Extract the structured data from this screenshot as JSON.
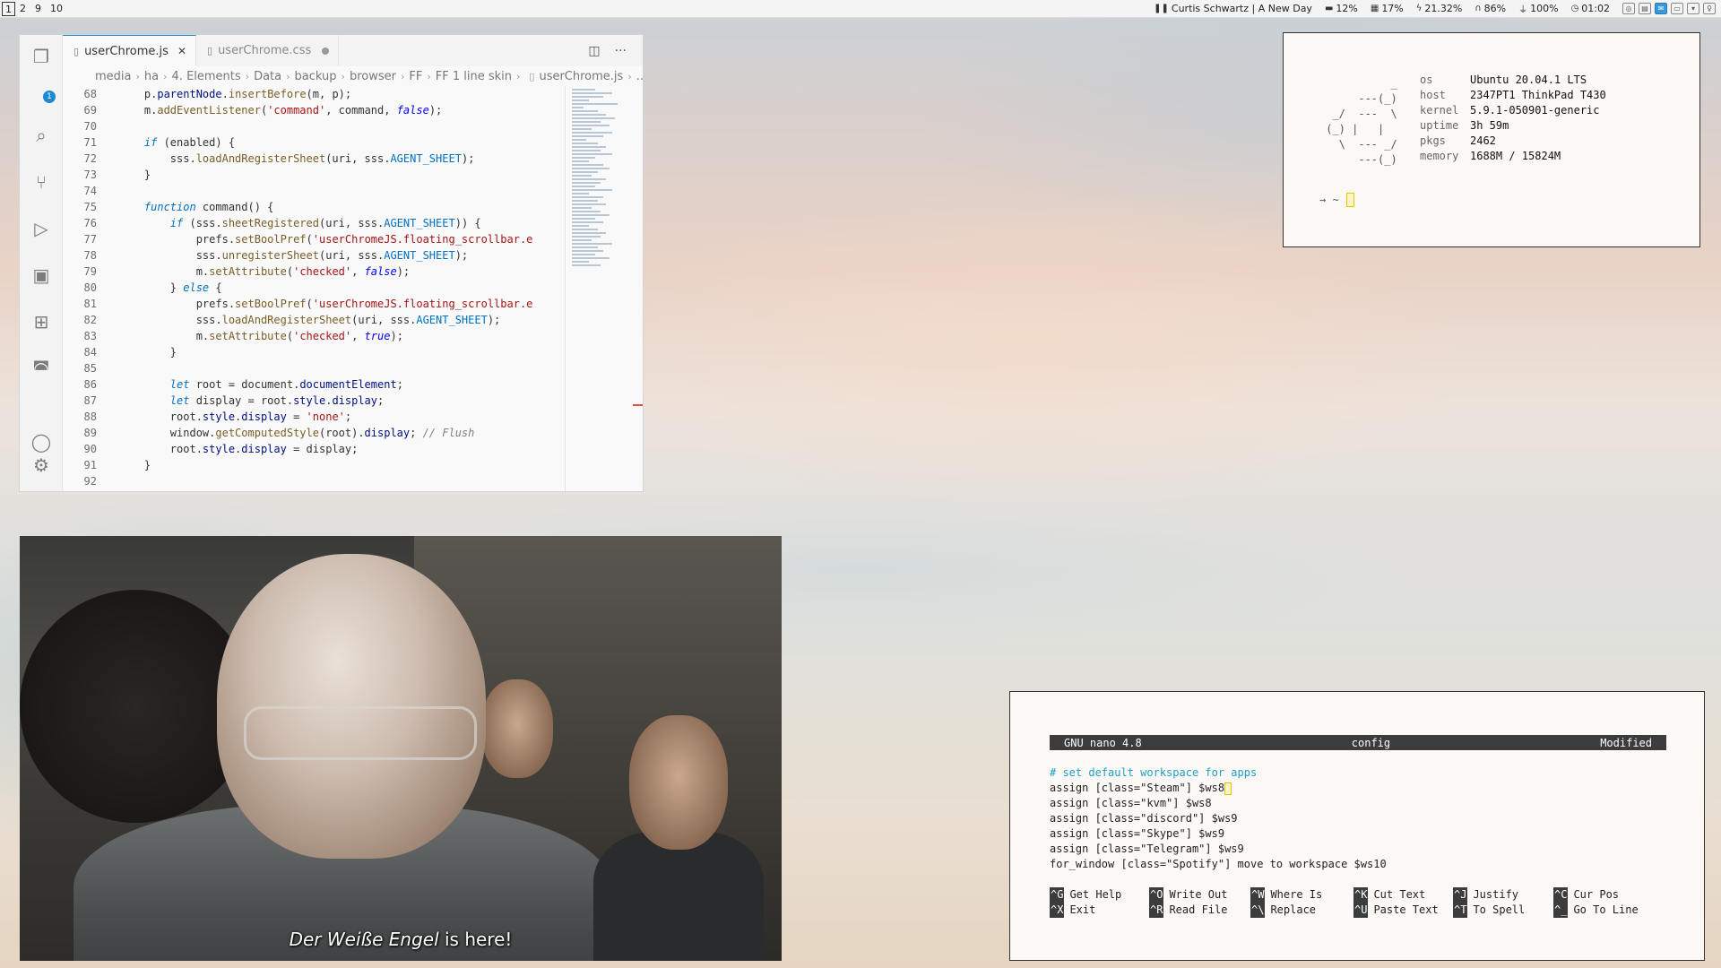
{
  "topbar": {
    "workspaces": [
      "1",
      "2",
      "9",
      "10"
    ],
    "active_workspace": "1",
    "now_playing": "Curtis Schwartz | A New Day",
    "disk": "12%",
    "memory": "17%",
    "cpu": "21.32%",
    "volume": "86%",
    "battery": "100%",
    "clock": "01:02"
  },
  "vscode": {
    "tabs": [
      {
        "label": "userChrome.js",
        "active": true
      },
      {
        "label": "userChrome.css",
        "active": false
      }
    ],
    "breadcrumb": [
      "media",
      "ha",
      "4. Elements",
      "Data",
      "backup",
      "browser",
      "FF",
      "FF 1 line skin",
      "userChrome.js",
      "..."
    ],
    "explorer_badge": "1",
    "lines": [
      {
        "n": "68",
        "text": "p.parentNode.insertBefore(m, p);"
      },
      {
        "n": "69",
        "text": "m.addEventListener('command', command, false);"
      },
      {
        "n": "70",
        "text": ""
      },
      {
        "n": "71",
        "text": "if (enabled) {"
      },
      {
        "n": "72",
        "text": "    sss.loadAndRegisterSheet(uri, sss.AGENT_SHEET);"
      },
      {
        "n": "73",
        "text": "}"
      },
      {
        "n": "74",
        "text": ""
      },
      {
        "n": "75",
        "text": "function command() {"
      },
      {
        "n": "76",
        "text": "    if (sss.sheetRegistered(uri, sss.AGENT_SHEET)) {"
      },
      {
        "n": "77",
        "text": "        prefs.setBoolPref('userChromeJS.floating_scrollbar.e"
      },
      {
        "n": "78",
        "text": "        sss.unregisterSheet(uri, sss.AGENT_SHEET);"
      },
      {
        "n": "79",
        "text": "        m.setAttribute('checked', false);"
      },
      {
        "n": "80",
        "text": "    } else {"
      },
      {
        "n": "81",
        "text": "        prefs.setBoolPref('userChromeJS.floating_scrollbar.e"
      },
      {
        "n": "82",
        "text": "        sss.loadAndRegisterSheet(uri, sss.AGENT_SHEET);"
      },
      {
        "n": "83",
        "text": "        m.setAttribute('checked', true);"
      },
      {
        "n": "84",
        "text": "    }"
      },
      {
        "n": "85",
        "text": ""
      },
      {
        "n": "86",
        "text": "    let root = document.documentElement;"
      },
      {
        "n": "87",
        "text": "    let display = root.style.display;"
      },
      {
        "n": "88",
        "text": "    root.style.display = 'none';"
      },
      {
        "n": "89",
        "text": "    window.getComputedStyle(root).display; // Flush"
      },
      {
        "n": "90",
        "text": "    root.style.display = display;"
      },
      {
        "n": "91",
        "text": "}"
      },
      {
        "n": "92",
        "text": ""
      }
    ]
  },
  "neofetch": {
    "rows": [
      {
        "key": "os",
        "value": "Ubuntu 20.04.1 LTS"
      },
      {
        "key": "host",
        "value": "2347PT1 ThinkPad T430"
      },
      {
        "key": "kernel",
        "value": "5.9.1-050901-generic"
      },
      {
        "key": "uptime",
        "value": "3h 59m"
      },
      {
        "key": "pkgs",
        "value": "2462"
      },
      {
        "key": "memory",
        "value": "1688M / 15824M"
      }
    ],
    "prompt": "→  ~"
  },
  "video": {
    "subtitle_italic": "Der Weiße Engel",
    "subtitle_rest": " is here!"
  },
  "nano": {
    "version": "GNU nano 4.8",
    "filename": "config",
    "state": "Modified",
    "lines": [
      "# set default workspace for apps",
      "assign [class=\"Steam\"] $ws8",
      "assign [class=\"kvm\"] $ws8",
      "assign [class=\"discord\"] $ws9",
      "assign [class=\"Skype\"] $ws9",
      "assign [class=\"Telegram\"] $ws9",
      "for_window [class=\"Spotify\"] move to workspace $ws10"
    ],
    "shortcuts": [
      {
        "key": "^G",
        "label": "Get Help"
      },
      {
        "key": "^O",
        "label": "Write Out"
      },
      {
        "key": "^W",
        "label": "Where Is"
      },
      {
        "key": "^K",
        "label": "Cut Text"
      },
      {
        "key": "^J",
        "label": "Justify"
      },
      {
        "key": "^C",
        "label": "Cur Pos"
      },
      {
        "key": "^X",
        "label": "Exit"
      },
      {
        "key": "^R",
        "label": "Read File"
      },
      {
        "key": "^\\",
        "label": "Replace"
      },
      {
        "key": "^U",
        "label": "Paste Text"
      },
      {
        "key": "^T",
        "label": "To Spell"
      },
      {
        "key": "^_",
        "label": "Go To Line"
      }
    ]
  }
}
